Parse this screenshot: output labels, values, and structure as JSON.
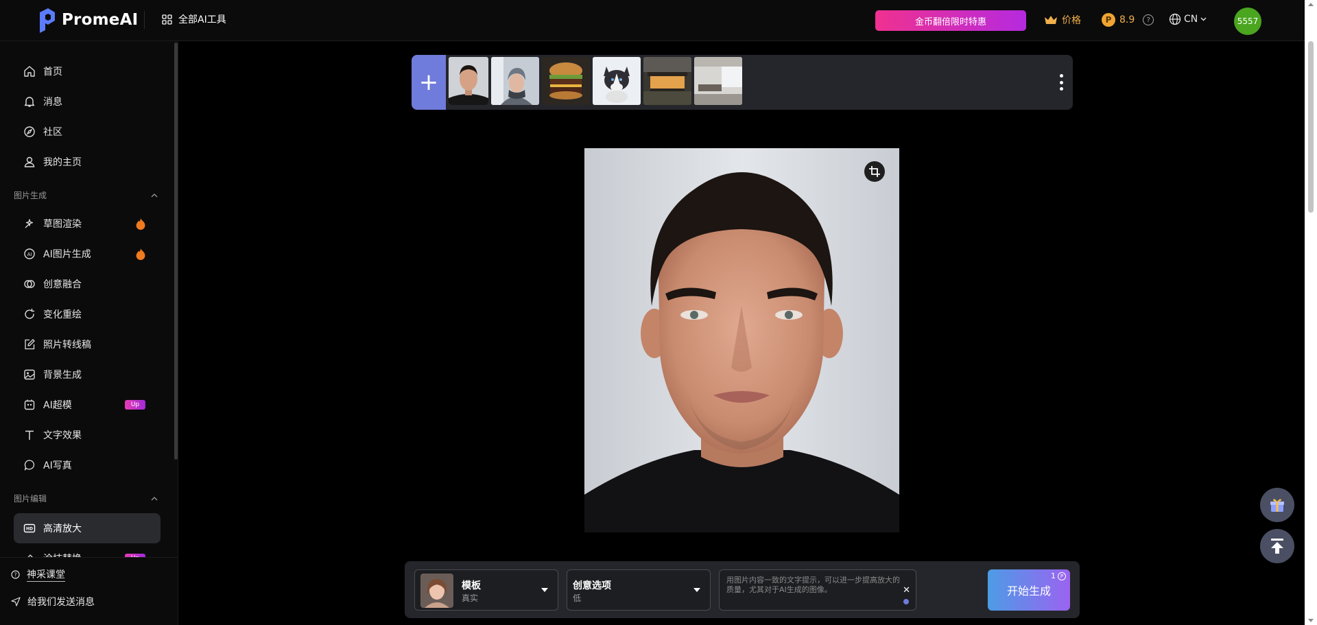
{
  "header": {
    "logo_text": "PromeAI",
    "all_tools_label": "全部AI工具",
    "promo_label": "金币翻倍限时特惠",
    "price_label": "价格",
    "coin_balance": "8.9",
    "language": "CN",
    "avatar_text": "5557"
  },
  "sidebar": {
    "top_items": [
      {
        "label": "首页",
        "icon": "home-icon"
      },
      {
        "label": "消息",
        "icon": "bell-icon"
      },
      {
        "label": "社区",
        "icon": "compass-icon"
      },
      {
        "label": "我的主页",
        "icon": "user-icon"
      }
    ],
    "section_image_gen": "图片生成",
    "image_gen_items": [
      {
        "label": "草图渲染",
        "icon": "sketch-icon",
        "badge": "hot"
      },
      {
        "label": "AI图片生成",
        "icon": "ai-image-icon",
        "badge": "hot"
      },
      {
        "label": "创意融合",
        "icon": "blend-icon"
      },
      {
        "label": "变化重绘",
        "icon": "refresh-icon"
      },
      {
        "label": "照片转线稿",
        "icon": "edit-icon"
      },
      {
        "label": "背景生成",
        "icon": "image-icon"
      },
      {
        "label": "AI超模",
        "icon": "model-icon",
        "badge": "Up"
      },
      {
        "label": "文字效果",
        "icon": "text-icon"
      },
      {
        "label": "AI写真",
        "icon": "portrait-icon"
      }
    ],
    "section_image_edit": "图片编辑",
    "image_edit_items": [
      {
        "label": "高清放大",
        "icon": "hd-icon",
        "active": true
      },
      {
        "label": "涂抹替换",
        "icon": "eraser-icon",
        "badge": "Up"
      }
    ],
    "footer": {
      "course_label": "神采课堂",
      "feedback_label": "给我们发送消息"
    }
  },
  "bottom": {
    "template_title": "模板",
    "template_value": "真实",
    "creative_title": "创意选项",
    "creative_value": "低",
    "prompt_placeholder": "用图片内容一致的文字提示，可以进一步提高放大的质量，尤其对于AI生成的图像。",
    "generate_label": "开始生成",
    "generate_cost": "1"
  },
  "colors": {
    "accent": "#6f7cdb",
    "promo_start": "#f0318f",
    "promo_end": "#b52adf",
    "avatar": "#4aa51f",
    "gold": "#f0b04b"
  }
}
